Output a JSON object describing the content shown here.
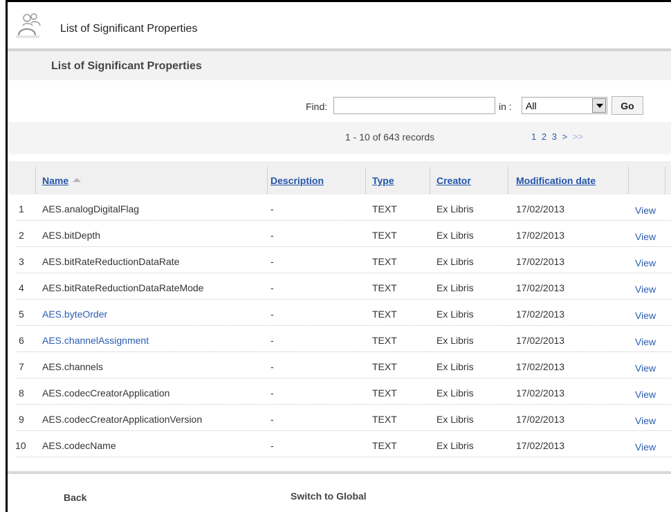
{
  "app": {
    "title": "List of Significant Properties",
    "icon": "users-icon"
  },
  "section": {
    "title": "List of Significant Properties"
  },
  "search": {
    "find_label": "Find:",
    "find_value": "",
    "in_label": "in :",
    "in_value": "All",
    "go_label": "Go"
  },
  "records": {
    "summary": "1 - 10 of 643 records",
    "pages": [
      "1",
      "2",
      "3"
    ],
    "next_label": ">",
    "last_label": ">>"
  },
  "table": {
    "columns": {
      "name": "Name",
      "description": "Description",
      "type": "Type",
      "creator": "Creator",
      "modification_date": "Modification date"
    },
    "rows": [
      {
        "num": "1",
        "name": "AES.analogDigitalFlag",
        "description": "-",
        "type": "TEXT",
        "creator": "Ex Libris",
        "date": "17/02/2013",
        "action": "View"
      },
      {
        "num": "2",
        "name": "AES.bitDepth",
        "description": "-",
        "type": "TEXT",
        "creator": "Ex Libris",
        "date": "17/02/2013",
        "action": "View"
      },
      {
        "num": "3",
        "name": "AES.bitRateReductionDataRate",
        "description": "-",
        "type": "TEXT",
        "creator": "Ex Libris",
        "date": "17/02/2013",
        "action": "View"
      },
      {
        "num": "4",
        "name": "AES.bitRateReductionDataRateMode",
        "description": "-",
        "type": "TEXT",
        "creator": "Ex Libris",
        "date": "17/02/2013",
        "action": "View"
      },
      {
        "num": "5",
        "name": "AES.byteOrder",
        "description": "-",
        "type": "TEXT",
        "creator": "Ex Libris",
        "date": "17/02/2013",
        "action": "View"
      },
      {
        "num": "6",
        "name": "AES.channelAssignment",
        "description": "-",
        "type": "TEXT",
        "creator": "Ex Libris",
        "date": "17/02/2013",
        "action": "View"
      },
      {
        "num": "7",
        "name": "AES.channels",
        "description": "-",
        "type": "TEXT",
        "creator": "Ex Libris",
        "date": "17/02/2013",
        "action": "View"
      },
      {
        "num": "8",
        "name": "AES.codecCreatorApplication",
        "description": "-",
        "type": "TEXT",
        "creator": "Ex Libris",
        "date": "17/02/2013",
        "action": "View"
      },
      {
        "num": "9",
        "name": "AES.codecCreatorApplicationVersion",
        "description": "-",
        "type": "TEXT",
        "creator": "Ex Libris",
        "date": "17/02/2013",
        "action": "View"
      },
      {
        "num": "10",
        "name": "AES.codecName",
        "description": "-",
        "type": "TEXT",
        "creator": "Ex Libris",
        "date": "17/02/2013",
        "action": "View"
      }
    ]
  },
  "footer": {
    "back_label": "Back",
    "switch_label": "Switch to Global"
  },
  "colors": {
    "link": "#2a5db0",
    "header_bg": "#f2f2f2"
  }
}
